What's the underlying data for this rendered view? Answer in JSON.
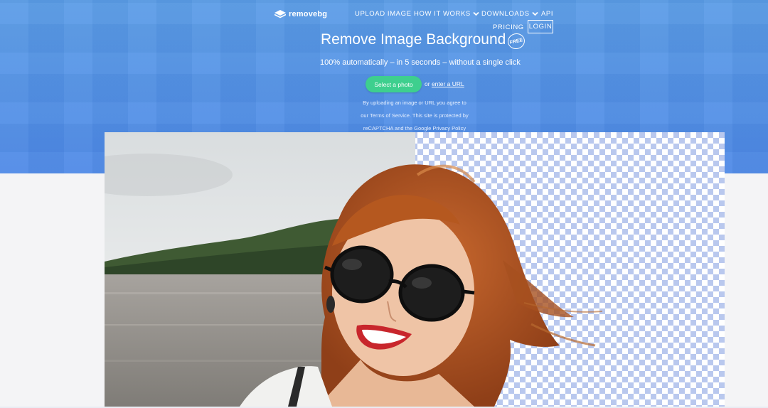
{
  "brand": {
    "name": "removebg",
    "logo_icon": "layers-icon"
  },
  "nav": {
    "upload_image": "UPLOAD IMAGE",
    "how_it_works": "HOW IT WORKS",
    "downloads": "DOWNLOADS",
    "api": "API",
    "pricing": "PRICING",
    "login": "LOGIN"
  },
  "hero": {
    "title": "Remove Image Background",
    "badge": "FREE",
    "subtitle": "100% automatically – in 5 seconds – without a single click",
    "select_button": "Select a photo",
    "or_text": "or",
    "url_link": "enter a URL",
    "disclaimer_line1": "By uploading an image or URL you agree to",
    "disclaimer_line2": "our Terms of Service. This site is protected by",
    "disclaimer_line3": "reCAPTCHA and the Google Privacy Policy"
  },
  "colors": {
    "hero_blue": "#4d88e6",
    "button_green": "#3ecf8e",
    "checker_blue": "#b9c8ee"
  },
  "demo_image": {
    "subject": "woman-with-sunglasses",
    "transparency_pattern": "checkerboard"
  }
}
